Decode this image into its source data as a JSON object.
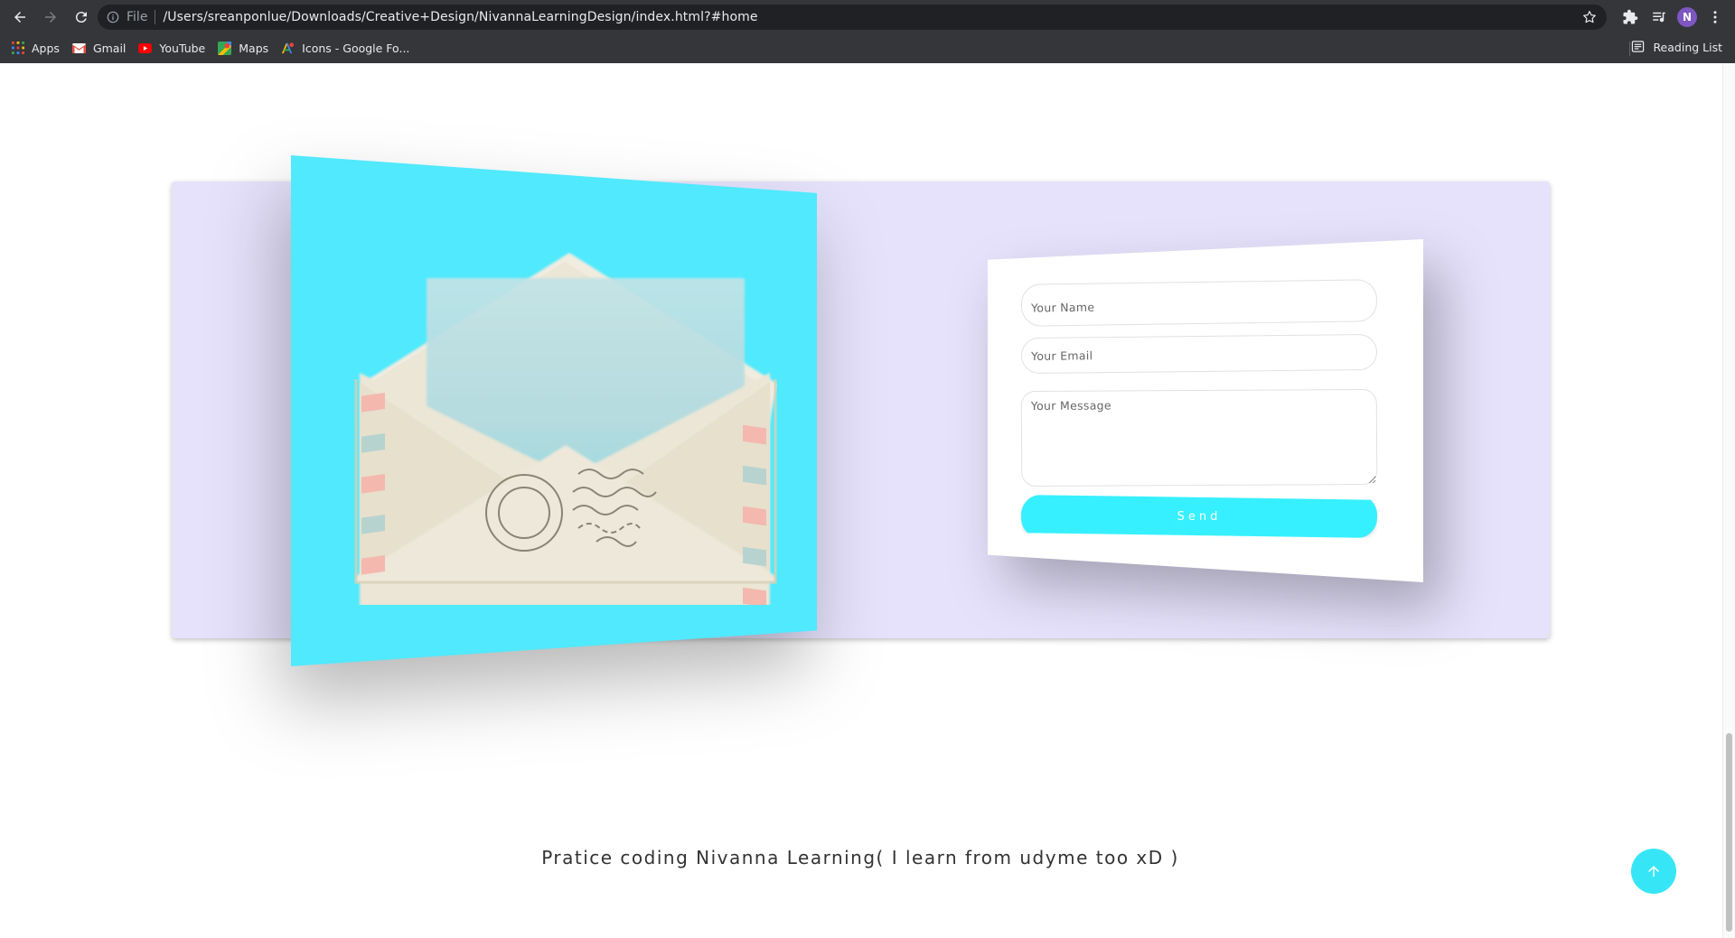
{
  "browser": {
    "url_scheme": "File",
    "url": "/Users/sreanponlue/Downloads/Creative+Design/NivannaLearningDesign/index.html?#home",
    "profile_initial": "N",
    "bookmarks": [
      {
        "label": "Apps",
        "icon": "apps-grid-icon"
      },
      {
        "label": "Gmail",
        "icon": "gmail-icon"
      },
      {
        "label": "YouTube",
        "icon": "youtube-icon"
      },
      {
        "label": "Maps",
        "icon": "maps-icon"
      },
      {
        "label": "Icons - Google Fo...",
        "icon": "google-fonts-icon"
      }
    ],
    "reading_list": "Reading List"
  },
  "contact_form": {
    "name_placeholder": "Your Name",
    "email_placeholder": "Your Email",
    "message_placeholder": "Your Message",
    "send_label": "Send"
  },
  "footer": {
    "text": "Pratice coding Nivanna Learning( I learn from udyme too xD )"
  },
  "colors": {
    "panel_bg": "#e6e2fc",
    "accent_cyan": "#50e9fd",
    "button_cyan": "#37f0ff"
  }
}
